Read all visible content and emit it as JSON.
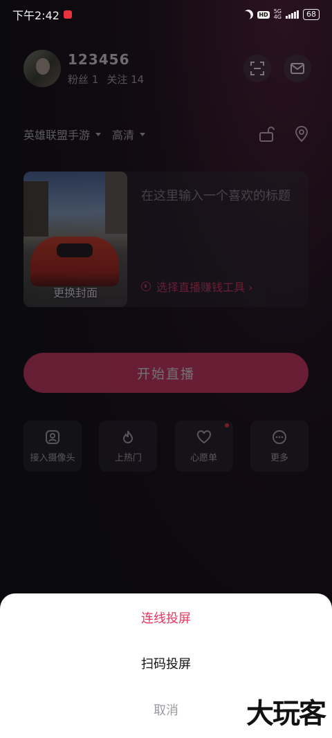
{
  "status_bar": {
    "time": "下午2:42",
    "hd": "HD",
    "network": "5G",
    "network_sub": "4G",
    "battery": "68"
  },
  "profile": {
    "username": "123456",
    "fans_label": "粉丝",
    "fans_count": "1",
    "following_label": "关注",
    "following_count": "14"
  },
  "category": {
    "game": "英雄联盟手游",
    "quality": "高清"
  },
  "live_card": {
    "cover_label": "更换封面",
    "title_placeholder": "在这里输入一个喜欢的标题",
    "earn_tool": "选择直播赚钱工具 ›"
  },
  "start_button": "开始直播",
  "tools": [
    {
      "label": "接入摄像头",
      "icon": "camera-icon"
    },
    {
      "label": "上热门",
      "icon": "flame-icon"
    },
    {
      "label": "心愿单",
      "icon": "heart-icon"
    },
    {
      "label": "更多",
      "icon": "more-icon"
    }
  ],
  "sheet": {
    "option1": "连线投屏",
    "option2": "扫码投屏",
    "cancel": "取消"
  },
  "watermark": "大玩客",
  "colors": {
    "accent": "#e8355f",
    "background": "#0b0a0e"
  }
}
